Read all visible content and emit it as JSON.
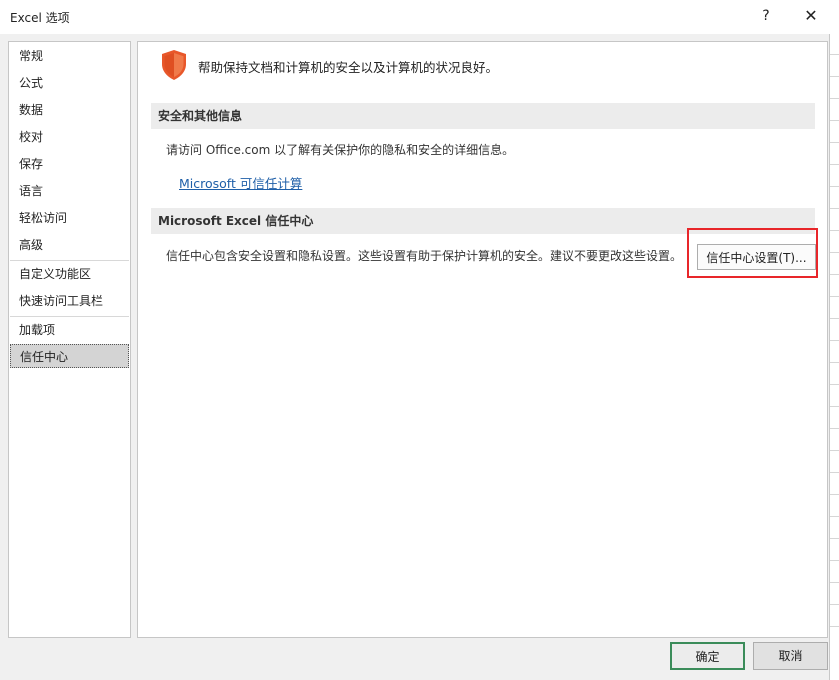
{
  "window": {
    "title": "Excel 选项",
    "help_glyph": "?",
    "close_glyph": "✕"
  },
  "nav": {
    "items": [
      {
        "label": "常规"
      },
      {
        "label": "公式"
      },
      {
        "label": "数据"
      },
      {
        "label": "校对"
      },
      {
        "label": "保存"
      },
      {
        "label": "语言"
      },
      {
        "label": "轻松访问"
      },
      {
        "label": "高级"
      },
      {
        "label": "自定义功能区"
      },
      {
        "label": "快速访问工具栏"
      },
      {
        "label": "加载项"
      },
      {
        "label": "信任中心"
      }
    ],
    "selected": "信任中心"
  },
  "content": {
    "intro": "帮助保持文档和计算机的安全以及计算机的状况良好。",
    "icon": "shield-icon",
    "accent_color": "#e8572a",
    "sections": [
      {
        "header": "安全和其他信息",
        "text": "请访问 Office.com 以了解有关保护你的隐私和安全的详细信息。",
        "link": "Microsoft 可信任计算"
      },
      {
        "header": "Microsoft Excel 信任中心",
        "text": "信任中心包含安全设置和隐私设置。这些设置有助于保护计算机的安全。建议不要更改这些设置。",
        "button": "信任中心设置(T)..."
      }
    ],
    "highlight_color": "#e8262a"
  },
  "footer": {
    "ok": "确定",
    "cancel": "取消"
  }
}
